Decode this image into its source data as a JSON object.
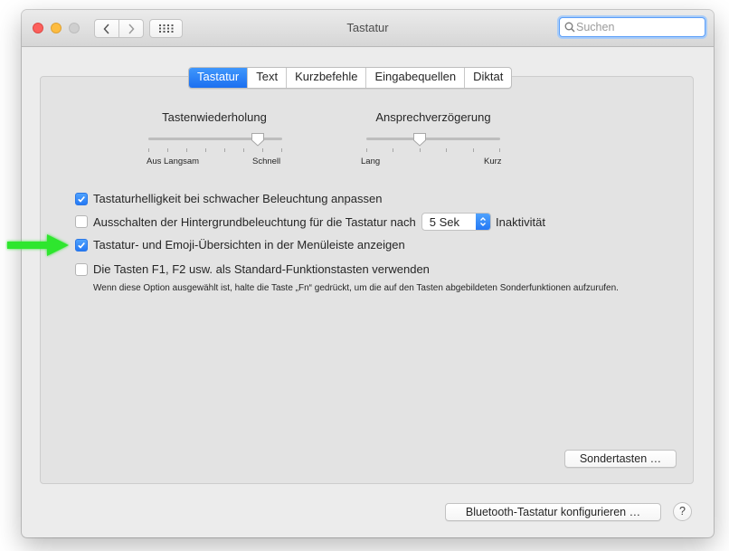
{
  "window": {
    "title": "Tastatur"
  },
  "search": {
    "placeholder": "Suchen",
    "value": ""
  },
  "tabs": [
    {
      "label": "Tastatur",
      "selected": true
    },
    {
      "label": "Text",
      "selected": false
    },
    {
      "label": "Kurzbefehle",
      "selected": false
    },
    {
      "label": "Eingabequellen",
      "selected": false
    },
    {
      "label": "Diktat",
      "selected": false
    }
  ],
  "sliders": {
    "key_repeat": {
      "title": "Tastenwiederholung",
      "labels": [
        "Aus",
        "Langsam",
        "Schnell"
      ],
      "value_fraction": 0.83
    },
    "delay_until_repeat": {
      "title": "Ansprechverzögerung",
      "labels": [
        "Lang",
        "Kurz"
      ],
      "value_fraction": 0.4
    }
  },
  "options": [
    {
      "label": "Tastaturhelligkeit bei schwacher Beleuchtung anpassen",
      "checked": true
    },
    {
      "label": "Ausschalten der Hintergrundbeleuchtung für die Tastatur nach",
      "checked": false,
      "select_value": "5 Sek",
      "suffix": "Inaktivität"
    },
    {
      "label": "Tastatur- und Emoji-Übersichten in der Menüleiste anzeigen",
      "checked": true
    },
    {
      "label": "Die Tasten F1, F2 usw. als Standard-Funktionstasten verwenden",
      "checked": false,
      "hint": "Wenn diese Option ausgewählt ist, halte die Taste „Fn“ gedrückt, um die auf den Tasten abgebildeten Sonderfunktionen aufzurufen."
    }
  ],
  "buttons": {
    "modifier_keys": "Sondertasten …",
    "bluetooth": "Bluetooth-Tastatur konfigurieren …",
    "help": "?"
  },
  "colors": {
    "accent": "#1c6ff0",
    "annotation_arrow": "#2ee62e"
  }
}
